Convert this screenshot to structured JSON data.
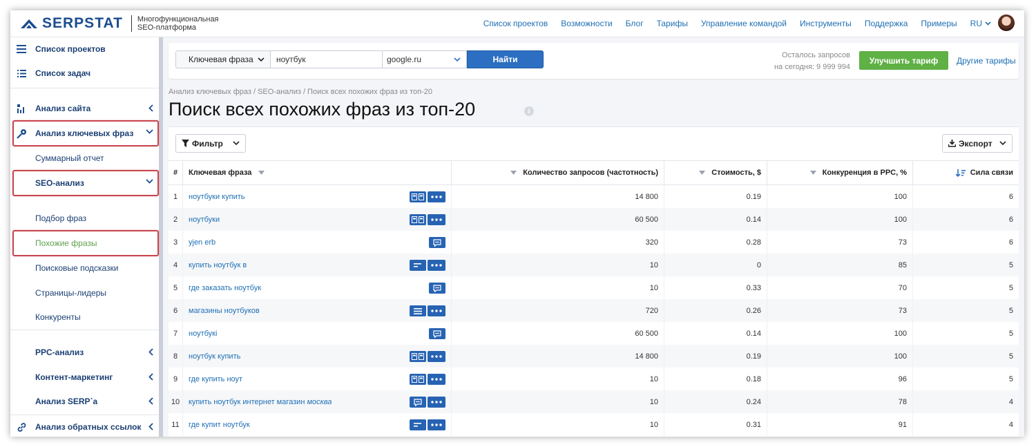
{
  "header": {
    "brand": "SERPSTAT",
    "tagline_line1": "Многофункциональная",
    "tagline_line2": "SEO-платформа",
    "nav": [
      "Список проектов",
      "Возможности",
      "Блог",
      "Тарифы",
      "Управление командой",
      "Инструменты",
      "Поддержка",
      "Примеры"
    ],
    "language": "RU"
  },
  "sidebar": {
    "project_list": "Список проектов",
    "task_list": "Список задач",
    "site_analysis": "Анализ сайта",
    "keyword_analysis": "Анализ ключевых фраз",
    "summary_report": "Суммарный отчет",
    "seo_analysis": "SEO-анализ",
    "phrase_selection": "Подбор фраз",
    "similar_phrases": "Похожие фразы",
    "search_suggestions": "Поисковые подсказки",
    "leader_pages": "Страницы-лидеры",
    "competitors": "Конкуренты",
    "ppc_analysis": "PPC-анализ",
    "content_marketing": "Контент-маркетинг",
    "serp_analysis": "Анализ SERP`а",
    "backlink_analysis": "Анализ обратных ссылок"
  },
  "search": {
    "type_label": "Ключевая фраза",
    "query": "ноутбук",
    "engine": "google.ru",
    "find_label": "Найти",
    "quota_line1": "Осталось запросов",
    "quota_line2": "на сегодня: 9 999 994",
    "upgrade_label": "Улучшить тариф",
    "other_plans_label": "Другие тарифы"
  },
  "breadcrumb": "Анализ ключевых фраз / SEO-анализ / Поиск всех похожих фраз из топ-20",
  "page_title": "Поиск всех похожих фраз из топ-20",
  "info_icon_glyph": "i",
  "toolbar": {
    "filter_label": "Фильтр",
    "export_label": "Экспорт"
  },
  "table": {
    "headers": {
      "num": "#",
      "keyword": "Ключевая фраза",
      "volume": "Количество запросов (частотность)",
      "cost": "Стоимость, $",
      "competition": "Конкуренция в PPC, %",
      "strength": "Сила связи"
    },
    "rows": [
      {
        "num": "1",
        "keyword": "ноутбуки купить",
        "keyword_em": "",
        "volume": "14 800",
        "cost": "0.19",
        "competition": "100",
        "strength": "6",
        "badges": [
          "serp-features-icon",
          "more-dots-icon"
        ]
      },
      {
        "num": "2",
        "keyword": "ноутбуки",
        "keyword_em": "",
        "volume": "60 500",
        "cost": "0.14",
        "competition": "100",
        "strength": "6",
        "badges": [
          "serp-features-icon",
          "more-dots-icon"
        ]
      },
      {
        "num": "3",
        "keyword": "yjen erb",
        "keyword_em": "",
        "volume": "320",
        "cost": "0.28",
        "competition": "73",
        "strength": "6",
        "badges": [
          "speech-bubble-icon"
        ]
      },
      {
        "num": "4",
        "keyword": "купить ноутбук в",
        "keyword_em": "",
        "volume": "10",
        "cost": "0",
        "competition": "85",
        "strength": "5",
        "badges": [
          "snippet-lines-icon",
          "more-dots-icon"
        ]
      },
      {
        "num": "5",
        "keyword": "где заказать ноутбук",
        "keyword_em": "",
        "volume": "10",
        "cost": "0.33",
        "competition": "70",
        "strength": "5",
        "badges": [
          "speech-bubble-icon"
        ]
      },
      {
        "num": "6",
        "keyword": "магазины ноутбуков",
        "keyword_em": "",
        "volume": "720",
        "cost": "0.26",
        "competition": "73",
        "strength": "5",
        "badges": [
          "list-icon",
          "more-dots-icon"
        ]
      },
      {
        "num": "7",
        "keyword": "ноутбукі",
        "keyword_em": "",
        "volume": "60 500",
        "cost": "0.14",
        "competition": "100",
        "strength": "5",
        "badges": [
          "speech-bubble-icon"
        ]
      },
      {
        "num": "8",
        "keyword": "ноутбук купить",
        "keyword_em": "",
        "volume": "14 800",
        "cost": "0.19",
        "competition": "100",
        "strength": "5",
        "badges": [
          "serp-features-icon",
          "more-dots-icon"
        ]
      },
      {
        "num": "9",
        "keyword": "где купить ноут",
        "keyword_em": "",
        "volume": "10",
        "cost": "0.18",
        "competition": "96",
        "strength": "5",
        "badges": [
          "serp-features-icon",
          "more-dots-icon"
        ]
      },
      {
        "num": "10",
        "keyword": "купить ноутбук интернет магазин ",
        "keyword_em": "москва",
        "volume": "10",
        "cost": "0.24",
        "competition": "78",
        "strength": "4",
        "badges": [
          "speech-bubble-icon",
          "more-dots-icon"
        ]
      },
      {
        "num": "11",
        "keyword": "где купит ноутбук",
        "keyword_em": "",
        "volume": "10",
        "cost": "0.31",
        "competition": "91",
        "strength": "4",
        "badges": [
          "snippet-lines-icon",
          "more-dots-icon"
        ]
      }
    ]
  },
  "colors": {
    "brand_blue": "#1b4d8f",
    "link_blue": "#1e6fb4",
    "button_blue": "#2c6fc2",
    "badge_blue": "#2763b3",
    "upgrade_green": "#5fb045",
    "active_green": "#5da24b",
    "highlight_red": "#c8454d"
  }
}
